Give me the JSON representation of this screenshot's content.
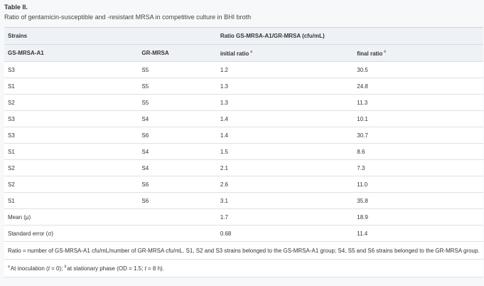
{
  "caption": {
    "label": "Table II.",
    "title": "Ratio of gentamicin-susceptible and -resistant MRSA in competitive culture in BHI broth"
  },
  "header": {
    "strains": "Strains",
    "ratio_group": "Ratio GS-MRSA-A1/GR-MRSA (cfu/mL)",
    "col_gs": "GS-MRSA-A1",
    "col_gr": "GR-MRSA",
    "col_initial": "initial ratio",
    "col_initial_mark": "a",
    "col_final": "final ratio",
    "col_final_mark": "b"
  },
  "rows": [
    {
      "gs": "S3",
      "gr": "S5",
      "initial": "1.2",
      "final": "30.5"
    },
    {
      "gs": "S1",
      "gr": "S5",
      "initial": "1.3",
      "final": "24.8"
    },
    {
      "gs": "S2",
      "gr": "S5",
      "initial": "1.3",
      "final": "11.3"
    },
    {
      "gs": "S3",
      "gr": "S4",
      "initial": "1.4",
      "final": "10.1"
    },
    {
      "gs": "S3",
      "gr": "S6",
      "initial": "1.4",
      "final": "30.7"
    },
    {
      "gs": "S1",
      "gr": "S4",
      "initial": "1.5",
      "final": "8.6"
    },
    {
      "gs": "S2",
      "gr": "S4",
      "initial": "2.1",
      "final": "7.3"
    },
    {
      "gs": "S2",
      "gr": "S6",
      "initial": "2.6",
      "final": "11.0"
    },
    {
      "gs": "S1",
      "gr": "S6",
      "initial": "3.1",
      "final": "35.8"
    }
  ],
  "summary": [
    {
      "label": "Mean (μ)",
      "initial": "1.7",
      "final": "18.9"
    },
    {
      "label": "Standard error (σ)",
      "initial": "0.68",
      "final": "11.4"
    }
  ],
  "footnotes": {
    "note1": "Ratio = number of GS-MRSA-A1 cfu/mL/number of GR-MRSA cfu/mL. S1, S2 and S3 strains belonged to the GS-MRSA-A1 group; S4, S5 and S6 strains belonged to the GR-MRSA group.",
    "note2_mark_a": "a",
    "note2_part1": "At inoculation (",
    "note2_t1": "t",
    "note2_part2": " = 0); ",
    "note2_mark_b": "b",
    "note2_part3": "at stationary phase (OD = 1.5; ",
    "note2_t2": "t",
    "note2_part4": " = 8 h)."
  }
}
